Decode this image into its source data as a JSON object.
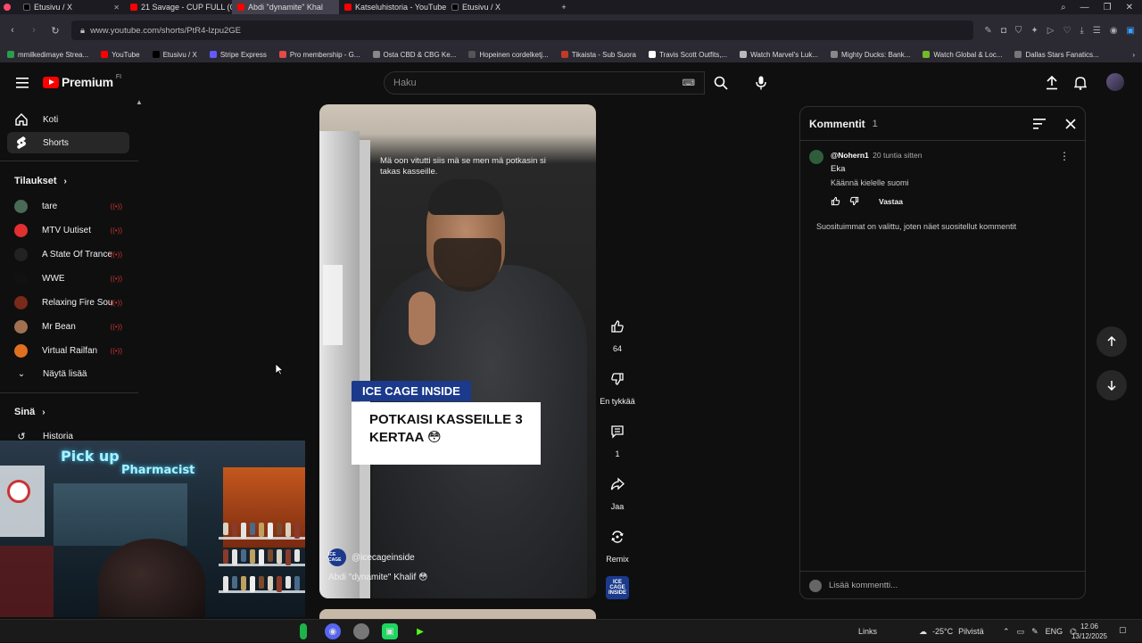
{
  "browser": {
    "tabs": [
      {
        "title": "Etusivu / X",
        "color": "#000000",
        "active": false
      },
      {
        "title": "21 Savage - CUP FULL (Of",
        "color": "#ff0000",
        "active": false
      },
      {
        "title": "Abdi \"dynamite\" Khal",
        "color": "#ff0000",
        "active": true
      },
      {
        "title": "Katseluhistoria - YouTube",
        "color": "#ff0000",
        "active": false
      },
      {
        "title": "Etusivu / X",
        "color": "#000000",
        "active": false
      }
    ],
    "new_tab": "+",
    "url": "www.youtube.com/shorts/PtR4-lzpu2GE",
    "bookmarks": [
      {
        "label": "mmilkedimaye Strea...",
        "color": "#2a9d4b"
      },
      {
        "label": "YouTube",
        "color": "#ff0000"
      },
      {
        "label": "Etusivu / X",
        "color": "#000000"
      },
      {
        "label": "Stripe Express",
        "color": "#635bff"
      },
      {
        "label": "Pro membership - G...",
        "color": "#e34a4a"
      },
      {
        "label": "Osta CBD & CBG Ke...",
        "color": "#888888"
      },
      {
        "label": "Hopeinen cordelketj...",
        "color": "#555555"
      },
      {
        "label": "Tikaista - Sub Suora",
        "color": "#c0392b"
      },
      {
        "label": "Travis Scott Outfits,...",
        "color": "#ffffff"
      },
      {
        "label": "Watch Marvel's Luk...",
        "color": "#bbbbbb"
      },
      {
        "label": "Mighty Ducks: Bank...",
        "color": "#888888"
      },
      {
        "label": "Watch Global & Loc...",
        "color": "#76b82a"
      },
      {
        "label": "Dallas Stars Fanatics...",
        "color": "#777777"
      }
    ]
  },
  "yt": {
    "logo_word": "Premium",
    "logo_sup": "FI",
    "search_placeholder": "Haku",
    "accent": "#ff0000"
  },
  "sidebar": {
    "home": "Koti",
    "shorts": "Shorts",
    "subscriptions_heading": "Tilaukset",
    "channels": [
      {
        "name": "tare",
        "color": "#4a6a58",
        "live": true
      },
      {
        "name": "MTV Uutiset",
        "color": "#e03030",
        "live": true
      },
      {
        "name": "A State Of Trance",
        "color": "#222222",
        "live": true
      },
      {
        "name": "WWE",
        "color": "#111111",
        "live": true
      },
      {
        "name": "Relaxing Fire Sou...",
        "color": "#7a2a1a",
        "live": true
      },
      {
        "name": "Mr Bean",
        "color": "#a07050",
        "live": true
      },
      {
        "name": "Virtual Railfan",
        "color": "#e07020",
        "live": true
      }
    ],
    "show_more": "Näytä lisää",
    "you_heading": "Sinä",
    "history": "Historia"
  },
  "webcam": {
    "neon_pick": "Pick up",
    "neon_pharm": "Pharmacist"
  },
  "video": {
    "subtitle": "Mä oon vitutti siis mä se men mä potkasin si takas kasseille.",
    "tag": "ICE CAGE INSIDE",
    "card_text": "POTKAISI KASSEILLE 3 KERTAA 😳",
    "channel_badge": "ICE CAGE",
    "channel_handle": "@icecageinside",
    "title": "Abdi \"dynamite\" Khalif 😳"
  },
  "actions": {
    "like_count": "64",
    "dislike_label": "En tykkää",
    "comment_count": "1",
    "share_label": "Jaa",
    "remix_label": "Remix",
    "channel_thumb": "ICE CAGE INSIDE"
  },
  "comments": {
    "title": "Kommentit",
    "count": "1",
    "items": [
      {
        "user": "@Nohern1",
        "time": "20 tuntia sitten",
        "text": "Eka",
        "translate": "Käännä kielelle suomi",
        "reply": "Vastaa"
      }
    ],
    "notice": "Suosituimmat on valittu, joten näet suositellut kommentit",
    "add_placeholder": "Lisää kommentti..."
  },
  "taskbar": {
    "links": "Links",
    "temp": "-25°C",
    "weather": "Pilvistä",
    "lang": "ENG",
    "time": "12.06",
    "date": "13/12/2025"
  }
}
